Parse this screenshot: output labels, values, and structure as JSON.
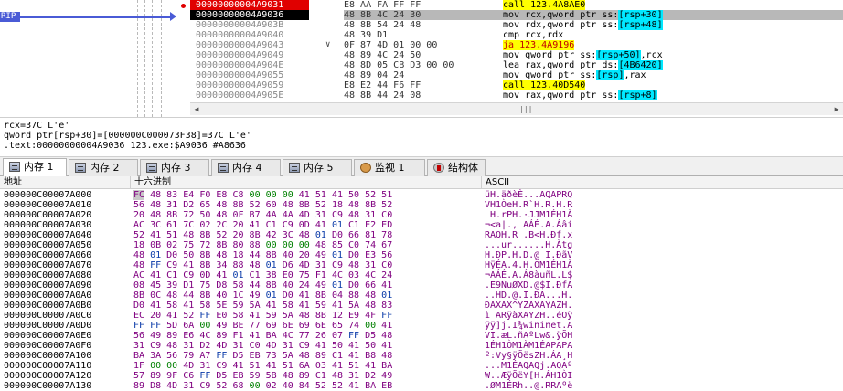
{
  "disassembly": {
    "rip_label": "RIP",
    "rows": [
      {
        "address": "00000000004A9031",
        "bytes": "E8 AA FA FF FF",
        "mnemonic": "call",
        "operand": "123.4A8AE0",
        "state": "bp",
        "style": "call",
        "marker": ""
      },
      {
        "address": "00000000004A9036",
        "bytes": "48 8B 4C 24 30",
        "mnemonic": "mov rcx,qword ptr ss:",
        "operand": "[rsp+30]",
        "state": "cur",
        "style": "mem",
        "marker": ""
      },
      {
        "address": "00000000004A903B",
        "bytes": "48 8B 54 24 48",
        "mnemonic": "mov rdx,qword ptr ss:",
        "operand": "[rsp+48]",
        "state": "",
        "style": "mem",
        "marker": ""
      },
      {
        "address": "00000000004A9040",
        "bytes": "48 39 D1",
        "mnemonic": "cmp rcx,rdx",
        "operand": "",
        "state": "",
        "style": "plain",
        "marker": ""
      },
      {
        "address": "00000000004A9043",
        "bytes": "0F 87 4D 01 00 00",
        "mnemonic": "ja",
        "operand": "123.4A9196",
        "state": "",
        "style": "jmp",
        "marker": "v"
      },
      {
        "address": "00000000004A9049",
        "bytes": "48 89 4C 24 50",
        "mnemonic": "mov qword ptr ss:",
        "operand": "[rsp+50]",
        "suffix": ",rcx",
        "state": "",
        "style": "mem",
        "marker": ""
      },
      {
        "address": "00000000004A904E",
        "bytes": "48 8D 05 CB D3 00 00",
        "mnemonic": "lea rax,qword ptr ds:",
        "operand": "[4B6420]",
        "state": "",
        "style": "mem",
        "marker": ""
      },
      {
        "address": "00000000004A9055",
        "bytes": "48 89 04 24",
        "mnemonic": "mov qword ptr ss:",
        "operand": "[rsp]",
        "suffix": ",rax",
        "state": "",
        "style": "mem",
        "marker": ""
      },
      {
        "address": "00000000004A9059",
        "bytes": "E8 E2 44 F6 FF",
        "mnemonic": "call",
        "operand": "123.40D540",
        "state": "",
        "style": "call",
        "marker": ""
      },
      {
        "address": "00000000004A905E",
        "bytes": "48 8B 44 24 08",
        "mnemonic": "mov rax,qword ptr ss:",
        "operand": "[rsp+8]",
        "state": "",
        "style": "mem",
        "marker": ""
      }
    ]
  },
  "info": {
    "lines": [
      "rcx=37C L'e'",
      "qword ptr[rsp+30]=[000000C000073F38]=37C L'e'",
      ".text:00000000004A9036 123.exe:$A9036 #A8636"
    ]
  },
  "tabs": [
    {
      "label": "内存 1",
      "icon": "memory-icon",
      "active": true
    },
    {
      "label": "内存 2",
      "icon": "memory-icon",
      "active": false
    },
    {
      "label": "内存 3",
      "icon": "memory-icon",
      "active": false
    },
    {
      "label": "内存 4",
      "icon": "memory-icon",
      "active": false
    },
    {
      "label": "内存 5",
      "icon": "memory-icon",
      "active": false
    },
    {
      "label": "监视 1",
      "icon": "watch-icon",
      "active": false
    },
    {
      "label": "结构体",
      "icon": "struct-icon",
      "active": false
    }
  ],
  "dump": {
    "headers": {
      "address": "地址",
      "hex": "十六进制",
      "ascii": "ASCII"
    },
    "rows": [
      {
        "address": "000000C00007A000",
        "hex": "FC 48 83 E4 F0 E8 C8 00 00 00 41 51 41 50 52 51",
        "ascii": "üH.äðèÈ...AQAPRQ"
      },
      {
        "address": "000000C00007A010",
        "hex": "56 48 31 D2 65 48 8B 52 60 48 8B 52 18 48 8B 52",
        "ascii": "VH1ÒeH.R`H.R.H.R"
      },
      {
        "address": "000000C00007A020",
        "hex": "20 48 8B 72 50 48 0F B7 4A 4A 4D 31 C9 48 31 C0",
        "ascii": " H.rPH.·JJM1ÉH1À"
      },
      {
        "address": "000000C00007A030",
        "hex": "AC 3C 61 7C 02 2C 20 41 C1 C9 0D 41 01 C1 E2 ED",
        "ascii": "¬<a|., AÁÉ.A.Áâí"
      },
      {
        "address": "000000C00007A040",
        "hex": "52 41 51 48 8B 52 20 8B 42 3C 48 01 D0 66 81 78",
        "ascii": "RAQH.R .B<H.Ðf.x"
      },
      {
        "address": "000000C00007A050",
        "hex": "18 0B 02 75 72 8B 80 88 00 00 00 48 85 C0 74 67",
        "ascii": "...ur......H.Àtg"
      },
      {
        "address": "000000C00007A060",
        "hex": "48 01 D0 50 8B 48 18 44 8B 40 20 49 01 D0 E3 56",
        "ascii": "H.ÐP.H.D.@ I.ÐãV"
      },
      {
        "address": "000000C00007A070",
        "hex": "48 FF C9 41 8B 34 88 48 01 D6 4D 31 C9 48 31 C0",
        "ascii": "HÿÉA.4.H.ÖM1ÉH1À"
      },
      {
        "address": "000000C00007A080",
        "hex": "AC 41 C1 C9 0D 41 01 C1 38 E0 75 F1 4C 03 4C 24",
        "ascii": "¬AÁÉ.A.Á8àuñL.L$"
      },
      {
        "address": "000000C00007A090",
        "hex": "08 45 39 D1 75 D8 58 44 8B 40 24 49 01 D0 66 41",
        "ascii": ".E9ÑuØXD.@$I.ÐfA"
      },
      {
        "address": "000000C00007A0A0",
        "hex": "8B 0C 48 44 8B 40 1C 49 01 D0 41 8B 04 88 48 01",
        "ascii": "..HD.@.I.ÐA...H."
      },
      {
        "address": "000000C00007A0B0",
        "hex": "D0 41 58 41 58 5E 59 5A 41 58 41 59 41 5A 48 83",
        "ascii": "ÐAXAX^YZAXAYAZH."
      },
      {
        "address": "000000C00007A0C0",
        "hex": "EC 20 41 52 FF E0 58 41 59 5A 48 8B 12 E9 4F FF",
        "ascii": "ì ARÿàXAYZH..éOÿ"
      },
      {
        "address": "000000C00007A0D0",
        "hex": "FF FF 5D 6A 00 49 BE 77 69 6E 69 6E 65 74 00 41",
        "ascii": "ÿÿ]j.I¾wininet.A"
      },
      {
        "address": "000000C00007A0E0",
        "hex": "56 49 89 E6 4C 89 F1 41 BA 4C 77 26 07 FF D5 48",
        "ascii": "VI.æL.ñAºLw&.ÿÕH"
      },
      {
        "address": "000000C00007A0F0",
        "hex": "31 C9 48 31 D2 4D 31 C0 4D 31 C9 41 50 41 50 41",
        "ascii": "1ÉH1ÒM1ÀM1ÉAPAPA"
      },
      {
        "address": "000000C00007A100",
        "hex": "BA 3A 56 79 A7 FF D5 EB 73 5A 48 89 C1 41 B8 48",
        "ascii": "º:Vy§ÿÕësZH.ÁA¸H"
      },
      {
        "address": "000000C00007A110",
        "hex": "1F 00 00 4D 31 C9 41 51 41 51 6A 03 41 51 41 BA",
        "ascii": "...M1ÉAQAQj.AQAº"
      },
      {
        "address": "000000C00007A120",
        "hex": "57 89 9F C6 FF D5 EB 59 5B 48 89 C1 48 31 D2 49",
        "ascii": "W..ÆÿÕëY[H.ÁH1ÒI"
      },
      {
        "address": "000000C00007A130",
        "hex": "89 D8 4D 31 C9 52 68 00 02 40 84 52 52 41 BA EB",
        "ascii": ".ØM1ÉRh..@.RRAºë"
      }
    ]
  },
  "colors": {
    "rip": "#4a5bd6",
    "breakpoint": "#e00000",
    "call_highlight": "#ffff00",
    "mem_highlight": "#00e8ff",
    "hex_text": "#800080",
    "hex_zero": "#008000"
  }
}
